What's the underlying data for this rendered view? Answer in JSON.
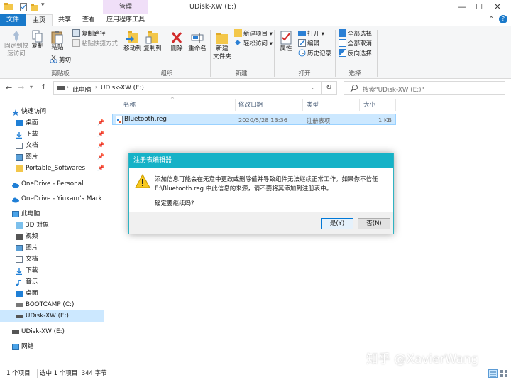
{
  "window": {
    "title": "UDisk-XW (E:)",
    "contextual_tab_header": "管理",
    "minimize": "—",
    "maximize": "☐",
    "close": "✕",
    "qat_dropdown": "▾"
  },
  "tabs": [
    "文件",
    "主页",
    "共享",
    "查看",
    "应用程序工具"
  ],
  "ribbon": {
    "clipboard": {
      "label": "剪贴板",
      "pin": "固定到快\n速访问",
      "copy": "复制",
      "paste": "粘贴",
      "copy_path": "复制路径",
      "paste_shortcut": "粘贴快捷方式",
      "cut": "剪切"
    },
    "organize": {
      "label": "组织",
      "move_to": "移动到",
      "copy_to": "复制到",
      "delete": "删除",
      "rename": "重命名"
    },
    "new": {
      "label": "新建",
      "new_folder": "新建\n文件夹",
      "new_item": "新建项目 ▾",
      "easy_access": "轻松访问 ▾"
    },
    "open": {
      "label": "打开",
      "properties": "属性",
      "open": "打开 ▾",
      "edit": "编辑",
      "history": "历史记录"
    },
    "select": {
      "label": "选择",
      "select_all": "全部选择",
      "select_none": "全部取消",
      "invert": "反向选择"
    },
    "collapse": "⌃",
    "help": "?"
  },
  "address": {
    "path_parts": [
      "此电脑",
      "UDisk-XW (E:)"
    ],
    "search_placeholder": "搜索\"UDisk-XW (E:)\""
  },
  "nav": {
    "quick_access": "快速访问",
    "quick_items": [
      "桌面",
      "下载",
      "文档",
      "图片",
      "Portable_Softwares"
    ],
    "onedrive_personal": "OneDrive - Personal",
    "onedrive_mark": "OneDrive - Yiukam's Mark",
    "this_pc": "此电脑",
    "pc_items": [
      "3D 对象",
      "视频",
      "图片",
      "文档",
      "下载",
      "音乐",
      "桌面",
      "BOOTCAMP (C:)",
      "UDisk-XW (E:)"
    ],
    "udisk": "UDisk-XW (E:)",
    "network": "网络"
  },
  "columns": {
    "name": "名称",
    "modified": "修改日期",
    "type": "类型",
    "size": "大小"
  },
  "files": [
    {
      "name": "Bluetooth.reg",
      "modified": "2020/5/28 13:36",
      "type": "注册表项",
      "size": "1 KB"
    }
  ],
  "dialog": {
    "title": "注册表编辑器",
    "line1": "添加信息可能会在无意中更改或删除值并导致组件无法继续正常工作。如果你不信任",
    "line2": "E:\\Bluetooth.reg 中此信息的来源，请不要将其添加到注册表中。",
    "question": "确定要继续吗?",
    "yes": "是(Y)",
    "no": "否(N)"
  },
  "status": {
    "count": "1 个项目",
    "selected": "选中 1 个项目  344 字节"
  },
  "watermark": "知乎 @XavierWang",
  "colors": {
    "accent_blue": "#1979ca",
    "dialog_title": "#16b2c7",
    "selected_row": "#cce8ff",
    "contextual_tab": "#f0dff8"
  }
}
